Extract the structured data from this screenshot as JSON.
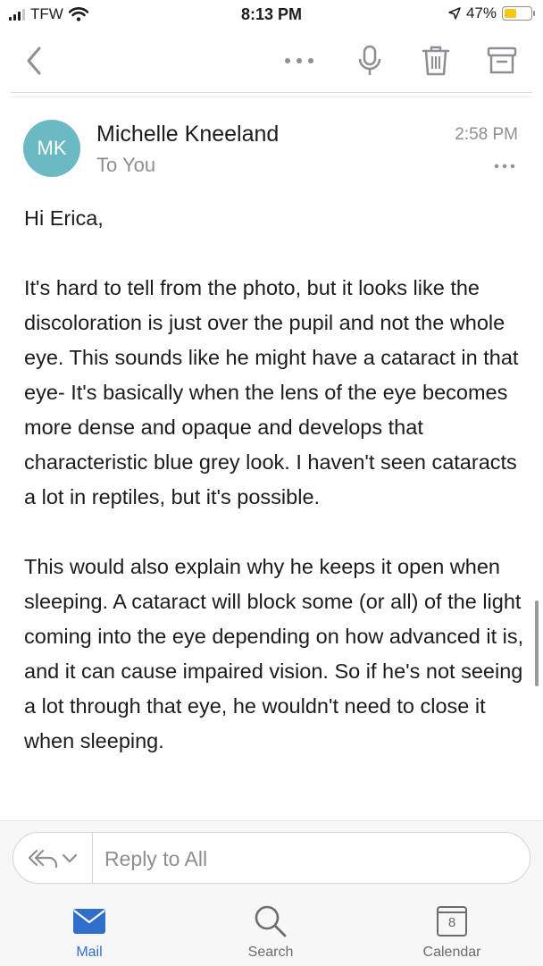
{
  "status_bar": {
    "carrier": "TFW",
    "time": "8:13 PM",
    "battery_text": "47%",
    "battery_level": 0.47,
    "battery_color": "#f5c518"
  },
  "toolbar": {
    "icons": [
      "back-chevron-icon",
      "more-horizontal-icon",
      "microphone-icon",
      "trash-icon",
      "archive-icon"
    ]
  },
  "message": {
    "avatar_initials": "MK",
    "avatar_color": "#6bb9c3",
    "sender": "Michelle Kneeland",
    "recipients": "To You",
    "time": "2:58 PM",
    "greeting": "Hi Erica,",
    "paragraph1": "It's hard to tell from the photo, but it looks like the discoloration is just over the pupil and not the whole eye. This sounds like he might have a cataract in that eye-  It's basically when the lens of the eye becomes more dense and opaque and develops that characteristic blue grey look. I haven't seen cataracts a lot in reptiles, but it's possible.",
    "paragraph2": "This would also explain why he keeps it open when sleeping. A cataract will block some (or all) of the light coming into the eye depending on how advanced it is, and it can cause impaired vision.  So if he's not seeing a lot through that eye, he wouldn't need to close it when sleeping."
  },
  "reply_bar": {
    "placeholder": "Reply to All"
  },
  "tab_bar": {
    "mail_label": "Mail",
    "search_label": "Search",
    "calendar_label": "Calendar",
    "calendar_day": "8",
    "active_tab": "Mail",
    "accent_color": "#2f6fcb"
  }
}
